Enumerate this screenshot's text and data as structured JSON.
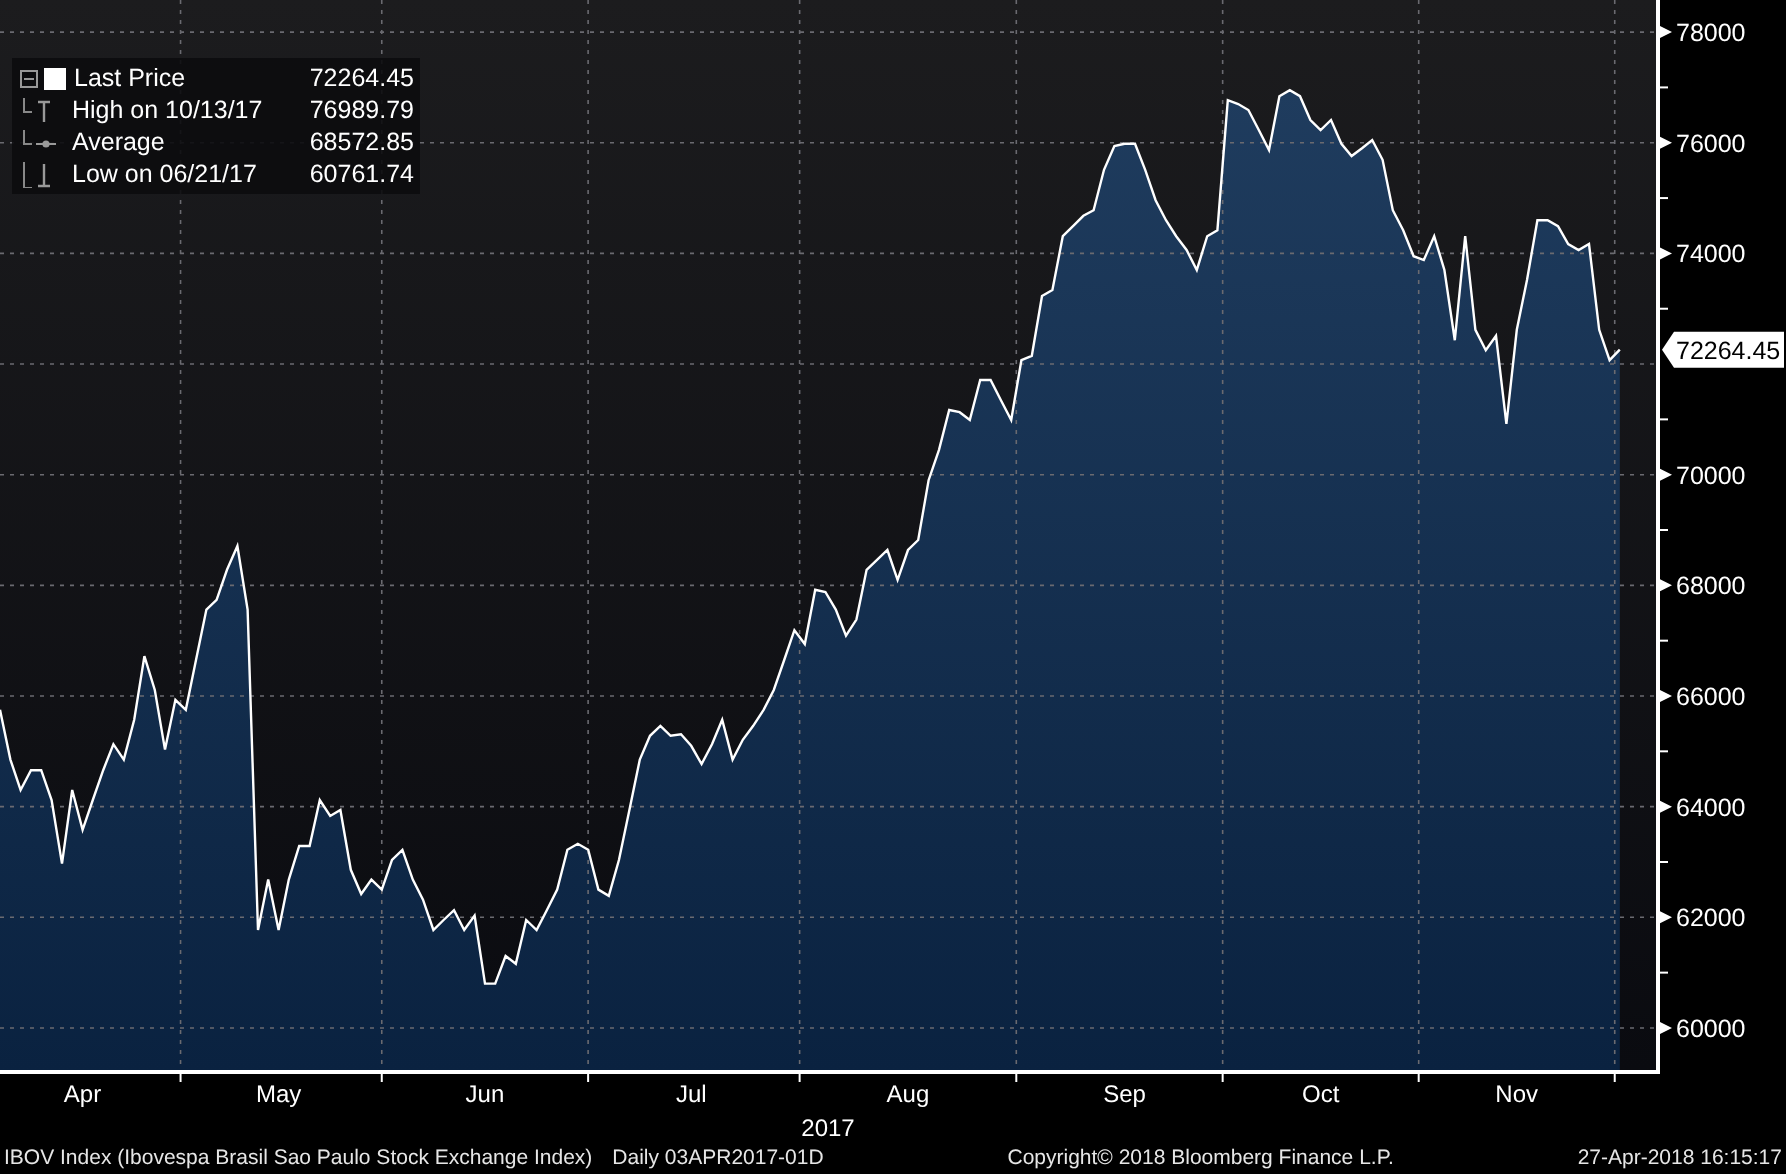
{
  "chart": {
    "chart_data": {
      "type": "area",
      "xlabel": "2017",
      "categories": [
        null,
        null,
        null,
        null,
        null,
        null,
        null,
        null,
        "Apr",
        null,
        null,
        null,
        null,
        null,
        null,
        null,
        null,
        null,
        null,
        null,
        null,
        null,
        null,
        null,
        null,
        null,
        null,
        "May",
        null,
        null,
        null,
        null,
        null,
        null,
        null,
        null,
        null,
        null,
        null,
        null,
        null,
        null,
        null,
        null,
        null,
        null,
        null,
        "Jun",
        null,
        null,
        null,
        null,
        null,
        null,
        null,
        null,
        null,
        null,
        null,
        null,
        null,
        null,
        null,
        null,
        null,
        null,
        null,
        "Jul",
        null,
        null,
        null,
        null,
        null,
        null,
        null,
        null,
        null,
        null,
        null,
        null,
        null,
        null,
        null,
        null,
        null,
        null,
        null,
        null,
        "Aug",
        null,
        null,
        null,
        null,
        null,
        null,
        null,
        null,
        null,
        null,
        null,
        null,
        null,
        null,
        null,
        null,
        null,
        null,
        null,
        null,
        "Sep",
        null,
        null,
        null,
        null,
        null,
        null,
        null,
        null,
        null,
        null,
        null,
        null,
        null,
        null,
        null,
        null,
        null,
        null,
        "Oct",
        null,
        null,
        null,
        null,
        null,
        null,
        null,
        null,
        null,
        null,
        null,
        null,
        null,
        null,
        null,
        null,
        null,
        null,
        "Nov",
        null,
        null,
        null,
        null,
        null,
        null,
        null,
        null,
        null,
        null
      ],
      "series": [
        {
          "name": "Last Price",
          "color": "#ffffff",
          "values": [
            65750,
            64850,
            64300,
            64660,
            64660,
            64120,
            62970,
            64300,
            63580,
            64120,
            64660,
            65130,
            64850,
            65570,
            66720,
            66110,
            65030,
            65930,
            65750,
            66650,
            67560,
            67740,
            68280,
            68710,
            67560,
            61770,
            62680,
            61770,
            62680,
            63290,
            63290,
            64120,
            63830,
            63940,
            62860,
            62420,
            62680,
            62500,
            63040,
            63220,
            62680,
            62320,
            61770,
            61950,
            62130,
            61770,
            62030,
            60800,
            60800,
            61300,
            61160,
            61950,
            61770,
            62130,
            62500,
            63220,
            63330,
            63220,
            62500,
            62390,
            63040,
            63940,
            64850,
            65280,
            65460,
            65280,
            65310,
            65100,
            64770,
            65130,
            65570,
            64850,
            65210,
            65460,
            65750,
            66110,
            66650,
            67190,
            66940,
            67920,
            67880,
            67560,
            67090,
            67380,
            68280,
            68460,
            68640,
            68100,
            68640,
            68820,
            69900,
            70450,
            71170,
            71130,
            70990,
            71710,
            71710,
            71350,
            70990,
            72070,
            72150,
            73230,
            73340,
            74310,
            74490,
            74680,
            74780,
            75510,
            75940,
            75980,
            75980,
            75510,
            74960,
            74600,
            74310,
            74060,
            73700,
            74310,
            74420,
            76770,
            76700,
            76590,
            76230,
            75870,
            76840,
            76950,
            76840,
            76410,
            76230,
            76410,
            75980,
            75760,
            75900,
            76050,
            75690,
            74780,
            74420,
            73950,
            73880,
            74310,
            73700,
            72430,
            74310,
            72620,
            72250,
            72510,
            70920,
            72620,
            73520,
            74600,
            74600,
            74490,
            74170,
            74060,
            74170,
            72620,
            72070,
            72260
          ]
        }
      ],
      "ylim": [
        59240,
        78580
      ],
      "grid": true,
      "yticks": [
        60000,
        62000,
        64000,
        66000,
        68000,
        70000,
        74000,
        76000,
        78000
      ]
    },
    "last_price_tag": "72264.45"
  },
  "legend": [
    {
      "kind": "last",
      "value": "72264.45"
    },
    {
      "kind": "high",
      "label": "High on 10/13/17",
      "value": "76989.79"
    },
    {
      "kind": "average",
      "label": "Average",
      "value": "68572.85"
    },
    {
      "kind": "low",
      "label": "Low on 06/21/17",
      "value": "60761.74"
    }
  ],
  "footer": {
    "security": "IBOV Index (Ibovespa Brasil Sao Paulo Stock Exchange Index)",
    "period": "Daily 03APR2017-01D",
    "copyright": "Copyright© 2018 Bloomberg Finance L.P.",
    "timestamp": "27-Apr-2018 16:15:17"
  }
}
